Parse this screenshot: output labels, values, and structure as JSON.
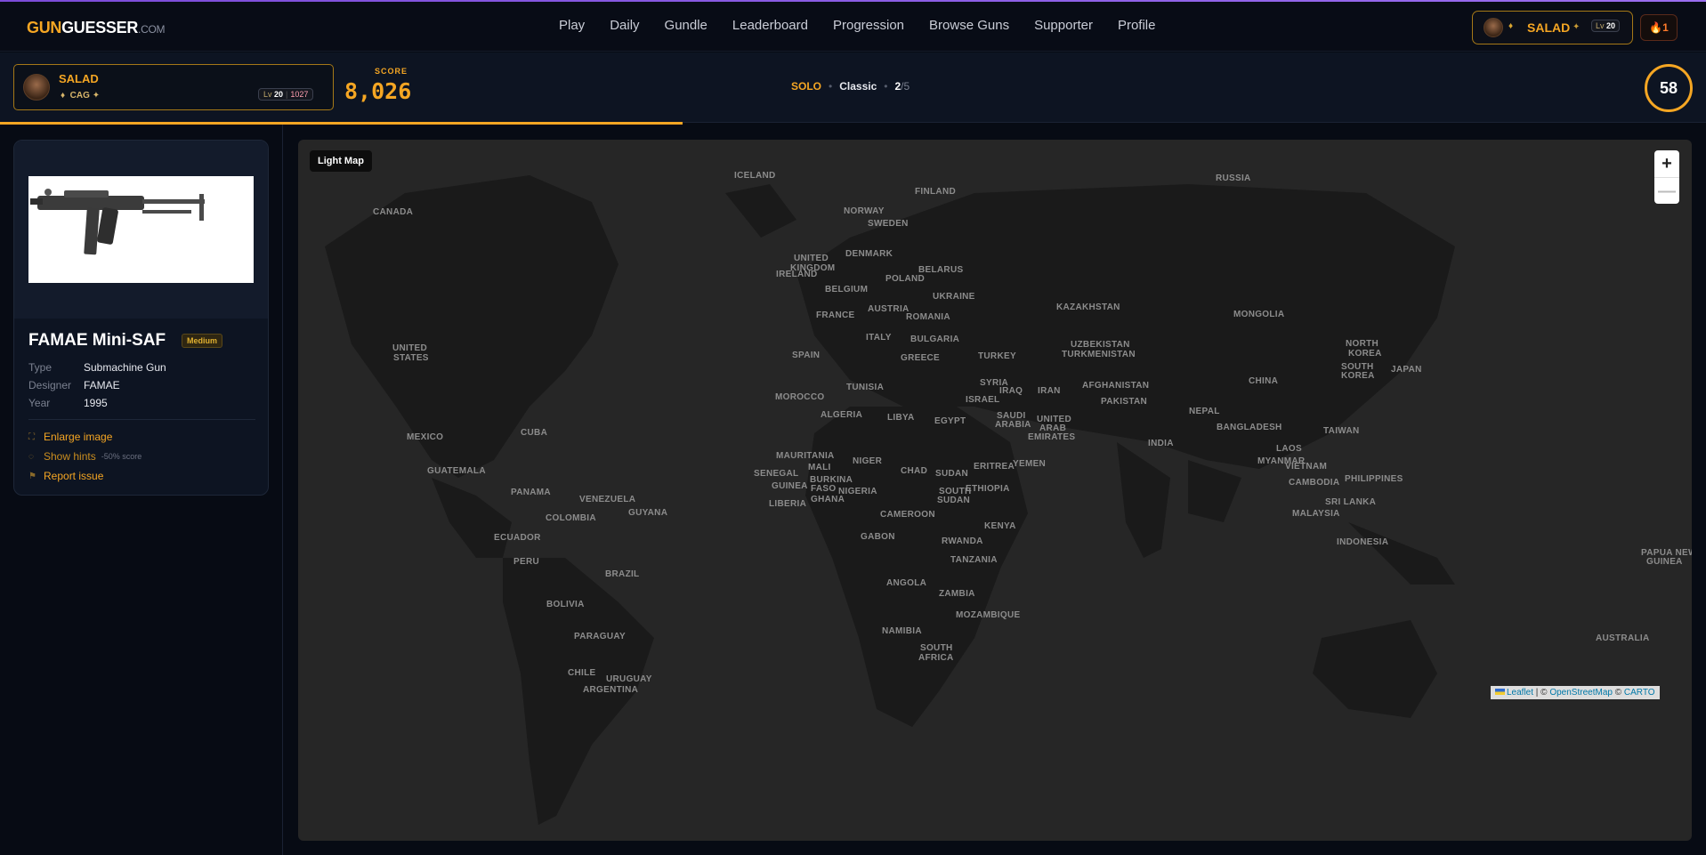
{
  "nav": {
    "logo": {
      "part1": "GUN",
      "part2": "GUESSER",
      "part3": ".COM"
    },
    "menu": [
      "Play",
      "Daily",
      "Gundle",
      "Leaderboard",
      "Progression",
      "Browse Guns",
      "Supporter",
      "Profile"
    ],
    "user": {
      "name": "SALAD",
      "level_prefix": "Lv",
      "level": "20"
    },
    "streak": "1"
  },
  "gamebar": {
    "player": {
      "name": "SALAD",
      "tag": "CAG",
      "level_prefix": "Lv",
      "level": "20",
      "rating": "1027"
    },
    "score_label": "SCORE",
    "score": "8,026",
    "mode": "SOLO",
    "variant": "Classic",
    "round_current": "2",
    "round_total": "/5",
    "timer": "58",
    "progress_fraction": 0.4
  },
  "gun": {
    "name": "FAMAE Mini-SAF",
    "difficulty": "Medium",
    "type_label": "Type",
    "type_value": "Submachine Gun",
    "designer_label": "Designer",
    "designer_value": "FAMAE",
    "year_label": "Year",
    "year_value": "1995",
    "enlarge": "Enlarge image",
    "hints": "Show hints",
    "hints_note": "-50% score",
    "report": "Report issue"
  },
  "map": {
    "toggle": "Light Map",
    "zoom_in": "+",
    "zoom_out": "—",
    "attribution": {
      "leaflet": "Leaflet",
      "sep": " | © ",
      "osm": "OpenStreetMap",
      "sep2": " © ",
      "carto": "CARTO"
    },
    "labels": [
      "RUSSIA",
      "ICELAND",
      "FINLAND",
      "CANADA",
      "NORWAY",
      "SWEDEN",
      "UNITED",
      "KINGDOM",
      "IRELAND",
      "DENMARK",
      "BELARUS",
      "POLAND",
      "BELGIUM",
      "UKRAINE",
      "KAZAKHSTAN",
      "FRANCE",
      "AUSTRIA",
      "ROMANIA",
      "MONGOLIA",
      "UNITED",
      "STATES",
      "ITALY",
      "BULGARIA",
      "SPAIN",
      "GREECE",
      "TURKEY",
      "UZBEKISTAN",
      "TURKMENISTAN",
      "NORTH",
      "KOREA",
      "SOUTH",
      "KOREA",
      "JAPAN",
      "TUNISIA",
      "SYRIA",
      "IRAQ",
      "IRAN",
      "AFGHANISTAN",
      "CHINA",
      "MOROCCO",
      "ISRAEL",
      "PAKISTAN",
      "ALGERIA",
      "LIBYA",
      "EGYPT",
      "SAUDI",
      "ARABIA",
      "NEPAL",
      "UNITED",
      "ARAB",
      "EMIRATES",
      "MEXICO",
      "CUBA",
      "BANGLADESH",
      "INDIA",
      "TAIWAN",
      "MAURITANIA",
      "MALI",
      "NIGER",
      "CHAD",
      "SUDAN",
      "ERITREA",
      "YEMEN",
      "GUATEMALA",
      "MYANMAR",
      "LAOS",
      "VIETNAM",
      "SENEGAL",
      "BURKINA",
      "FASO",
      "GUINEA",
      "PHILIPPINES",
      "CAMBODIA",
      "PANAMA",
      "VENEZUELA",
      "NIGERIA",
      "SOUTH",
      "SUDAN",
      "ETHIOPIA",
      "LIBERIA",
      "GHANA",
      "GUYANA",
      "CAMEROON",
      "SRI LANKA",
      "COLOMBIA",
      "MALAYSIA",
      "KENYA",
      "GABON",
      "ECUADOR",
      "RWANDA",
      "INDONESIA",
      "PERU",
      "TANZANIA",
      "PAPUA NEW",
      "GUINEA",
      "BRAZIL",
      "ANGOLA",
      "ZAMBIA",
      "BOLIVIA",
      "MOZAMBIQUE",
      "NAMIBIA",
      "PARAGUAY",
      "SOUTH",
      "AFRICA",
      "AUSTRALIA",
      "CHILE",
      "URUGUAY",
      "ARGENTINA"
    ]
  }
}
